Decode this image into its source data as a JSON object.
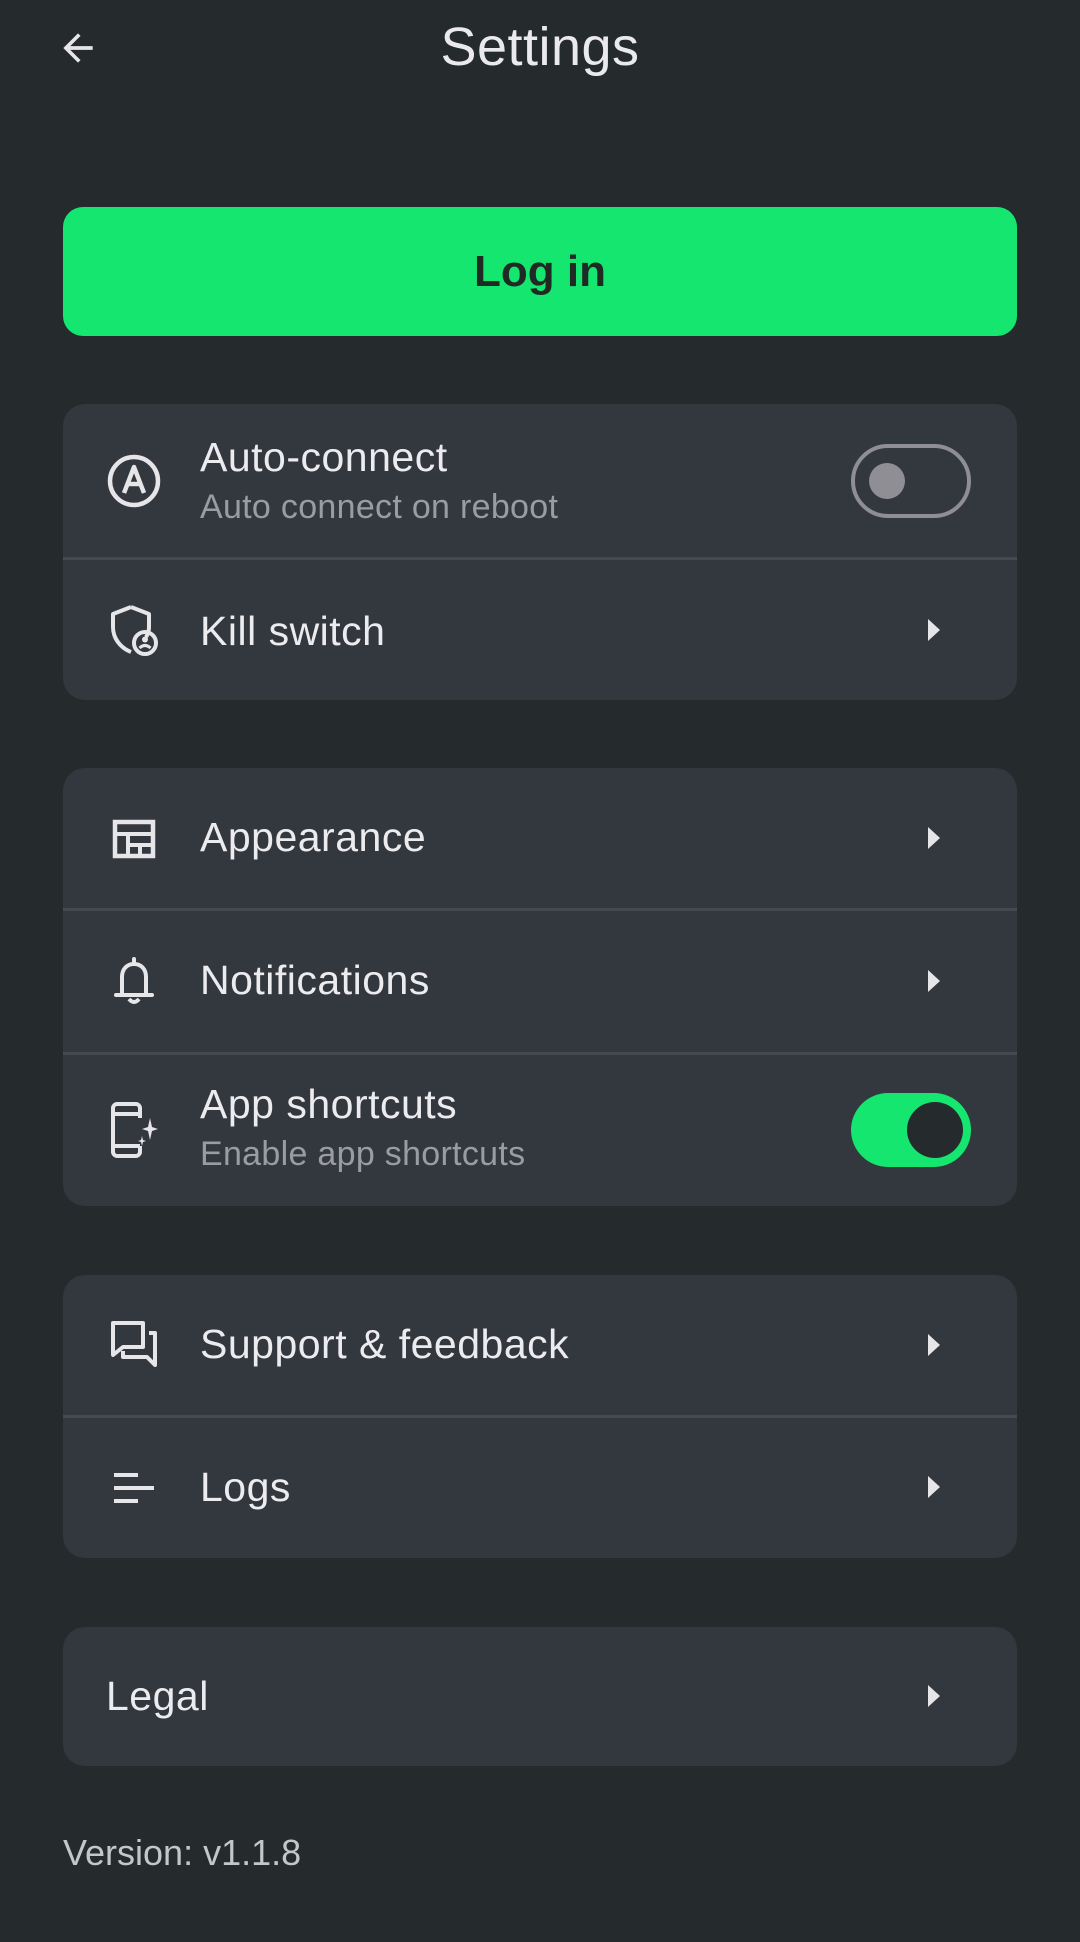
{
  "header": {
    "title": "Settings",
    "back_icon": "arrow-left-icon"
  },
  "login": {
    "label": "Log in",
    "color": "#14e670"
  },
  "group1": {
    "auto_connect": {
      "label": "Auto-connect",
      "sublabel": "Auto connect on reboot",
      "enabled": false,
      "icon": "circled-a-icon"
    },
    "kill_switch": {
      "label": "Kill switch",
      "icon": "shield-user-icon"
    }
  },
  "group2": {
    "appearance": {
      "label": "Appearance",
      "icon": "layout-icon"
    },
    "notifications": {
      "label": "Notifications",
      "icon": "bell-icon"
    },
    "app_shortcuts": {
      "label": "App shortcuts",
      "sublabel": "Enable app shortcuts",
      "enabled": true,
      "icon": "phone-sparkle-icon"
    }
  },
  "group3": {
    "support": {
      "label": "Support & feedback",
      "icon": "chat-icon"
    },
    "logs": {
      "label": "Logs",
      "icon": "lines-icon"
    }
  },
  "legal": {
    "label": "Legal"
  },
  "footer": {
    "version": "Version: v1.1.8"
  },
  "colors": {
    "background": "#252a2d",
    "card": "#33373e",
    "accent": "#14e670"
  }
}
